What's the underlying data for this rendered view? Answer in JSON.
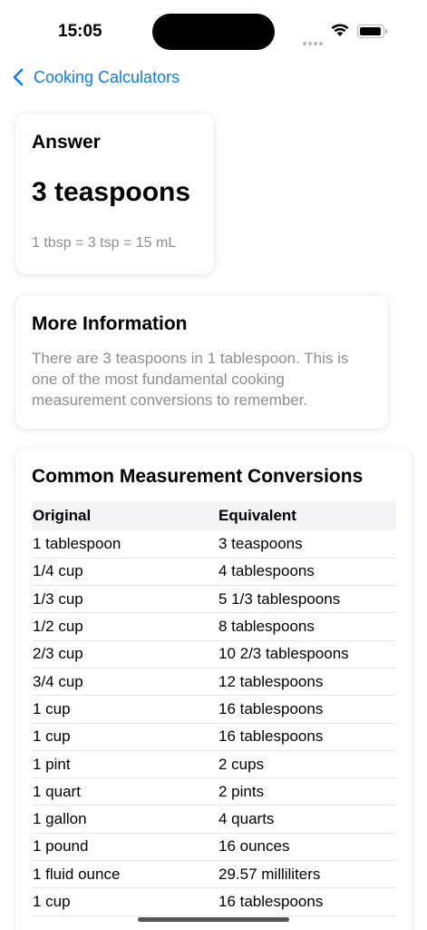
{
  "status_bar": {
    "time": "15:05"
  },
  "nav": {
    "back_label": "Cooking Calculators"
  },
  "answer": {
    "heading": "Answer",
    "value": "3 teaspoons",
    "note": "1 tbsp = 3 tsp = 15 mL"
  },
  "info": {
    "heading": "More Information",
    "lines": [
      "There are 3 teaspoons in 1 tablespoon. This is",
      "one of the most fundamental cooking",
      "measurement conversions to remember."
    ]
  },
  "table": {
    "title": "Common Measurement Conversions",
    "headers": [
      "Original",
      "Equivalent"
    ],
    "rows": [
      [
        "1 tablespoon",
        "3 teaspoons"
      ],
      [
        "1/4 cup",
        "4 tablespoons"
      ],
      [
        "1/3 cup",
        "5 1/3 tablespoons"
      ],
      [
        "1/2 cup",
        "8 tablespoons"
      ],
      [
        "2/3 cup",
        "10 2/3 tablespoons"
      ],
      [
        "3/4 cup",
        "12 tablespoons"
      ],
      [
        "1 cup",
        "16 tablespoons"
      ],
      [
        "1 cup",
        "16 tablespoons"
      ],
      [
        "1 pint",
        "2 cups"
      ],
      [
        "1 quart",
        "2 pints"
      ],
      [
        "1 gallon",
        "4 quarts"
      ],
      [
        "1 pound",
        "16 ounces"
      ],
      [
        "1 fluid ounce",
        "29.57 milliliters"
      ],
      [
        "1 cup",
        "16 tablespoons"
      ]
    ]
  },
  "colors": {
    "accent": "#0a7aff",
    "secondary_text": "#8e8e93"
  }
}
